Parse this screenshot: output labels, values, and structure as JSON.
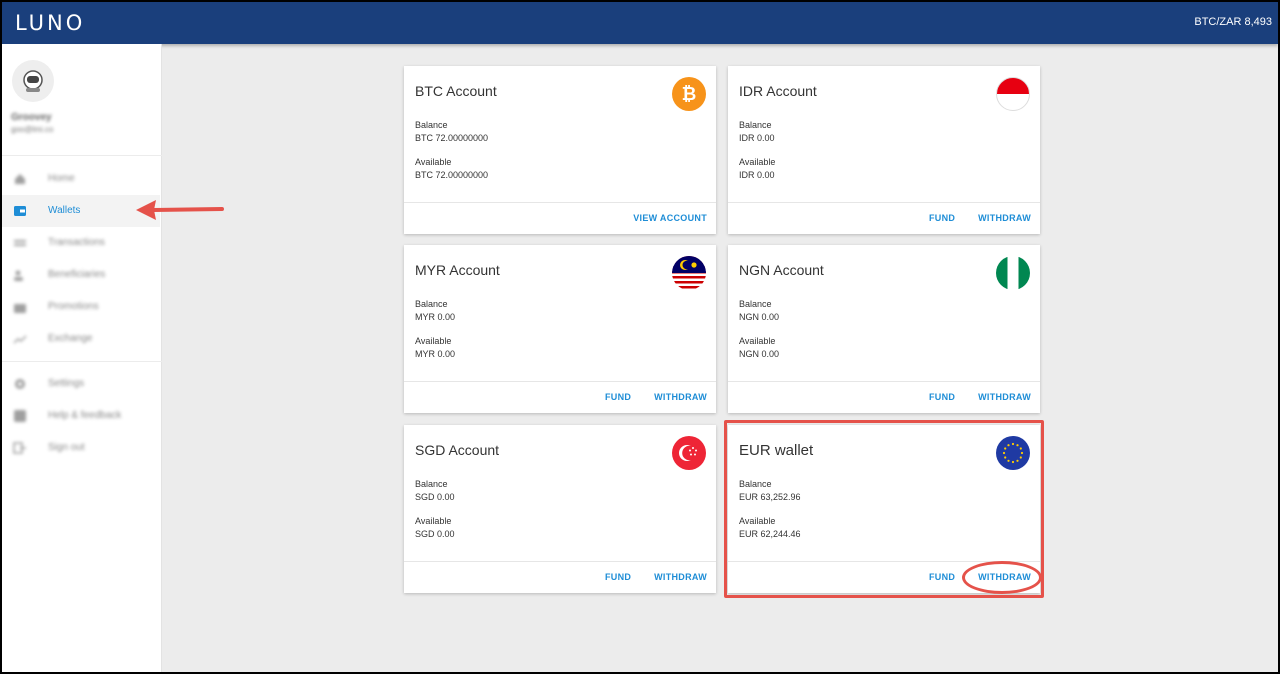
{
  "app": {
    "logo": "LUNO",
    "ticker": "BTC/ZAR 8,493"
  },
  "sidebar": {
    "user": {
      "name": "Groovey",
      "email": "goo@lmi.co"
    },
    "items": [
      {
        "label": "Home",
        "icon": "home-icon"
      },
      {
        "label": "Wallets",
        "icon": "wallet-icon",
        "active": true
      },
      {
        "label": "Transactions",
        "icon": "transactions-icon"
      },
      {
        "label": "Beneficiaries",
        "icon": "beneficiaries-icon"
      },
      {
        "label": "Promotions",
        "icon": "promotions-icon"
      },
      {
        "label": "Exchange",
        "icon": "exchange-icon"
      },
      {
        "label": "Settings",
        "icon": "gear-icon"
      },
      {
        "label": "Help & feedback",
        "icon": "help-icon"
      },
      {
        "label": "Sign out",
        "icon": "sign-out-icon"
      }
    ]
  },
  "accounts": [
    {
      "title": "BTC Account",
      "icon": "bitcoin-icon",
      "balance_label": "Balance",
      "balance": "BTC 72.00000000",
      "available_label": "Available",
      "available": "BTC 72.00000000",
      "actions": [
        "VIEW ACCOUNT"
      ]
    },
    {
      "title": "IDR Account",
      "icon": "indonesia-flag-icon",
      "balance_label": "Balance",
      "balance": "IDR 0.00",
      "available_label": "Available",
      "available": "IDR 0.00",
      "actions": [
        "FUND",
        "WITHDRAW"
      ]
    },
    {
      "title": "MYR Account",
      "icon": "malaysia-flag-icon",
      "balance_label": "Balance",
      "balance": "MYR 0.00",
      "available_label": "Available",
      "available": "MYR 0.00",
      "actions": [
        "FUND",
        "WITHDRAW"
      ]
    },
    {
      "title": "NGN Account",
      "icon": "nigeria-flag-icon",
      "balance_label": "Balance",
      "balance": "NGN 0.00",
      "available_label": "Available",
      "available": "NGN 0.00",
      "actions": [
        "FUND",
        "WITHDRAW"
      ]
    },
    {
      "title": "SGD Account",
      "icon": "singapore-flag-icon",
      "balance_label": "Balance",
      "balance": "SGD 0.00",
      "available_label": "Available",
      "available": "SGD 0.00",
      "actions": [
        "FUND",
        "WITHDRAW"
      ]
    },
    {
      "title": "EUR wallet",
      "icon": "eu-flag-icon",
      "balance_label": "Balance",
      "balance": "EUR 63,252.96",
      "available_label": "Available",
      "available": "EUR 62,244.46",
      "actions": [
        "FUND",
        "WITHDRAW"
      ]
    }
  ],
  "colors": {
    "topbar": "#1a3f7c",
    "accent": "#1e8dd6",
    "annotation": "#e5524a"
  }
}
